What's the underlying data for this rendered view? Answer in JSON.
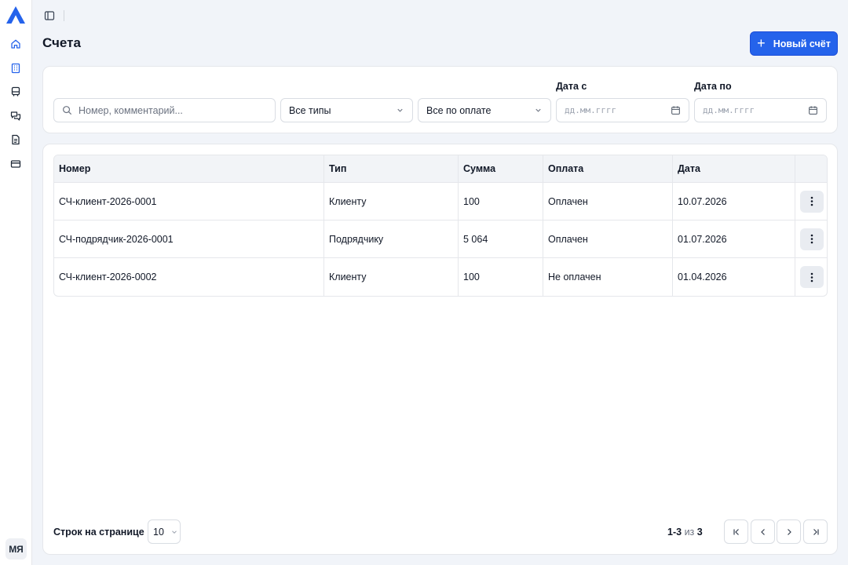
{
  "app": {
    "logo_icon": "logo-a-icon",
    "accent_color": "#2563eb"
  },
  "sidebar": {
    "items": [
      {
        "name": "home",
        "icon": "home-icon"
      },
      {
        "name": "buildings",
        "icon": "building-icon"
      },
      {
        "name": "transport",
        "icon": "bus-icon"
      },
      {
        "name": "messages",
        "icon": "chat-icon"
      },
      {
        "name": "documents",
        "icon": "document-icon"
      },
      {
        "name": "payments",
        "icon": "credit-card-icon"
      }
    ],
    "user_initials": "МЯ"
  },
  "header": {
    "title": "Счета",
    "new_button_label": "Новый счёт"
  },
  "filters": {
    "search_placeholder": "Номер, комментарий...",
    "type_select": "Все типы",
    "payment_select": "Все по оплате",
    "date_from_label": "Дата с",
    "date_from_placeholder": "дд.мм.гггг",
    "date_to_label": "Дата по",
    "date_to_placeholder": "дд.мм.гггг"
  },
  "table": {
    "columns": [
      "Номер",
      "Тип",
      "Сумма",
      "Оплата",
      "Дата"
    ],
    "rows": [
      [
        "СЧ-клиент-2026-0001",
        "Клиенту",
        "100",
        "Оплачен",
        "10.07.2026"
      ],
      [
        "СЧ-подрядчик-2026-0001",
        "Подрядчику",
        "5 064",
        "Оплачен",
        "01.07.2026"
      ],
      [
        "СЧ-клиент-2026-0002",
        "Клиенту",
        "100",
        "Не оплачен",
        "01.04.2026"
      ]
    ]
  },
  "pagination": {
    "rows_per_page_label": "Строк на странице",
    "rows_per_page_value": "10",
    "range": "1-3",
    "of_label": "из",
    "total": "3"
  }
}
